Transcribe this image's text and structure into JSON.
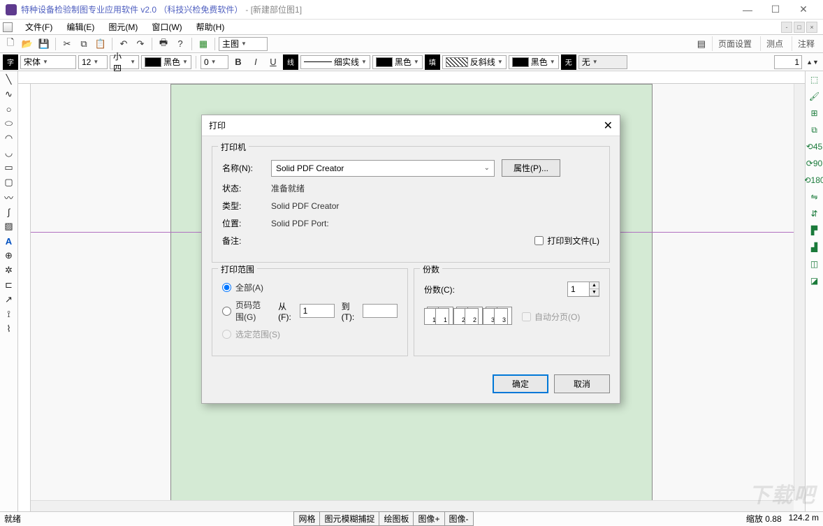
{
  "titlebar": {
    "app_title": "特种设备检验制图专业应用软件 v2.0 （科技兴检免费软件）",
    "doc_title": "- [新建部位图1]"
  },
  "menu": {
    "file": "文件(F)",
    "edit": "编辑(E)",
    "element": "图元(M)",
    "window": "窗口(W)",
    "help": "帮助(H)"
  },
  "toolbar1": {
    "main_view": "主图",
    "page_setup": "页面设置",
    "measure": "测点",
    "annotate": "注释"
  },
  "format": {
    "font_name": "宋体",
    "font_size": "12",
    "font_sizename": "小四",
    "font_color": "黑色",
    "stroke_width": "0",
    "bold": "B",
    "italic": "I",
    "underline": "U",
    "line_style": "细实线",
    "line_color": "黑色",
    "hatch_style": "反斜线",
    "hatch_color": "黑色",
    "fill_none": "无",
    "count": "1"
  },
  "statusbar": {
    "ready": "就绪",
    "buttons": [
      "网格",
      "图元模糊捕捉",
      "绘图板",
      "图像+",
      "图像-"
    ],
    "zoom": "缩放 0.88",
    "coord": "124.2 m"
  },
  "dialog": {
    "title": "打印",
    "printer_group": "打印机",
    "name_label": "名称(N):",
    "name_value": "Solid PDF Creator",
    "properties_btn": "属性(P)...",
    "status_label": "状态:",
    "status_value": "准备就绪",
    "type_label": "类型:",
    "type_value": "Solid PDF Creator",
    "where_label": "位置:",
    "where_value": "Solid PDF Port:",
    "comment_label": "备注:",
    "print_to_file": "打印到文件(L)",
    "range_group": "打印范围",
    "range_all": "全部(A)",
    "range_pages": "页码范围(G)",
    "from_label": "从(F):",
    "from_value": "1",
    "to_label": "到(T):",
    "range_selection": "选定范围(S)",
    "copies_group": "份数",
    "copies_label": "份数(C):",
    "copies_value": "1",
    "collate_label": "自动分页(O)",
    "ok": "确定",
    "cancel": "取消"
  },
  "watermark": "下载吧"
}
